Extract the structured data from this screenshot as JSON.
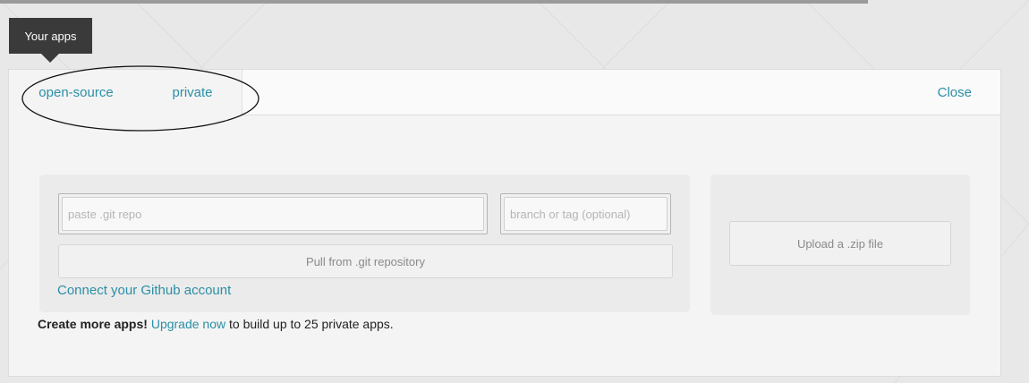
{
  "header": {
    "tab_label": "Your apps"
  },
  "tabs": [
    {
      "label": "open-source"
    },
    {
      "label": "private"
    }
  ],
  "close_label": "Close",
  "git": {
    "repo_placeholder": "paste .git repo",
    "repo_value": "",
    "branch_placeholder": "branch or tag (optional)",
    "branch_value": "",
    "pull_label": "Pull from .git repository",
    "github_link": "Connect your Github account"
  },
  "zip": {
    "upload_label": "Upload a .zip file"
  },
  "upgrade": {
    "bold": "Create more apps!",
    "link": "Upgrade now",
    "rest": "to build up to 25 private apps."
  },
  "colors": {
    "accent": "#2b8fa6",
    "dark_tab": "#3a3a3a",
    "panel": "#f4f4f4"
  },
  "annotation": {
    "shape": "hand-drawn ellipse around tabs"
  }
}
